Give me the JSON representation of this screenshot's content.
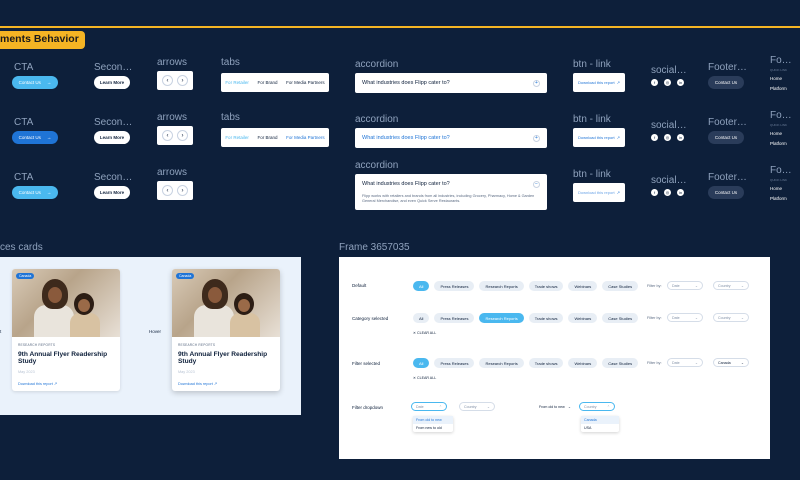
{
  "header": {
    "tag": "ments Behavior"
  },
  "colors": {
    "background": "#0d1f3a",
    "accent_yellow": "#f4b424",
    "cta_blue": "#4ab8ef",
    "cta_dark_blue": "#1f74d6"
  },
  "columns": {
    "cta": "CTA",
    "secondary": "Secon…",
    "arrows": "arrows",
    "tabs": "tabs",
    "accordion": "accordion",
    "btn_link": "btn - link",
    "social": "social…",
    "footer": "Footer…",
    "fo": "Fo…"
  },
  "cta_label": "Contact Us",
  "cta_arrow": "→",
  "secondary_label": "Learn More",
  "arrow_left": "‹",
  "arrow_right": "›",
  "tabs": [
    "For Retailer",
    "For Brand",
    "For Media Partners"
  ],
  "accordion": {
    "question": "What industries does Flipp cater to?",
    "closed_icon": "+",
    "open_icon": "−",
    "answer": "Flipp works with retailers and brands from all industries, including Grocery, Pharmacy, Home & Garden General Merchandise, and even Quick Serve Restaurants."
  },
  "btn_link": {
    "label": "Download this report",
    "icon": "↗"
  },
  "social_icons": [
    "facebook-icon",
    "instagram-icon",
    "linkedin-icon"
  ],
  "footer_button": "Contact Us",
  "fo_column": {
    "small": "QUICK LINK",
    "links": [
      "Home",
      "Platform"
    ]
  },
  "cards_section": {
    "label": "ces cards",
    "left_state_label": "t",
    "hover_label": "Hover",
    "card": {
      "badge": "Canada",
      "category": "RESEARCH REPORTS",
      "title": "9th Annual Flyer Readership Study",
      "date": "May 2023",
      "link": "Download this report",
      "link_icon": "↗"
    }
  },
  "frame": {
    "title": "Frame 3657035",
    "chips": [
      "All",
      "Press Releases",
      "Research Reports",
      "Trade shows",
      "Webinars",
      "Case Studies"
    ],
    "filter_by": "Filter by:",
    "date_label": "Date",
    "country_label": "Country",
    "canada_label": "Canada",
    "clear_all": "CLEAR ALL",
    "rows": [
      {
        "label": "Default",
        "active_chip": 0
      },
      {
        "label": "Category selected",
        "active_chip": 2
      },
      {
        "label": "Filter selected",
        "active_chip": 0
      }
    ],
    "dropdown_row": {
      "label": "Filter dropdown",
      "date_options": [
        "From old to new",
        "From new to old"
      ],
      "selected_sort": "From old to new",
      "country_options": [
        "Canada",
        "USA"
      ]
    }
  }
}
